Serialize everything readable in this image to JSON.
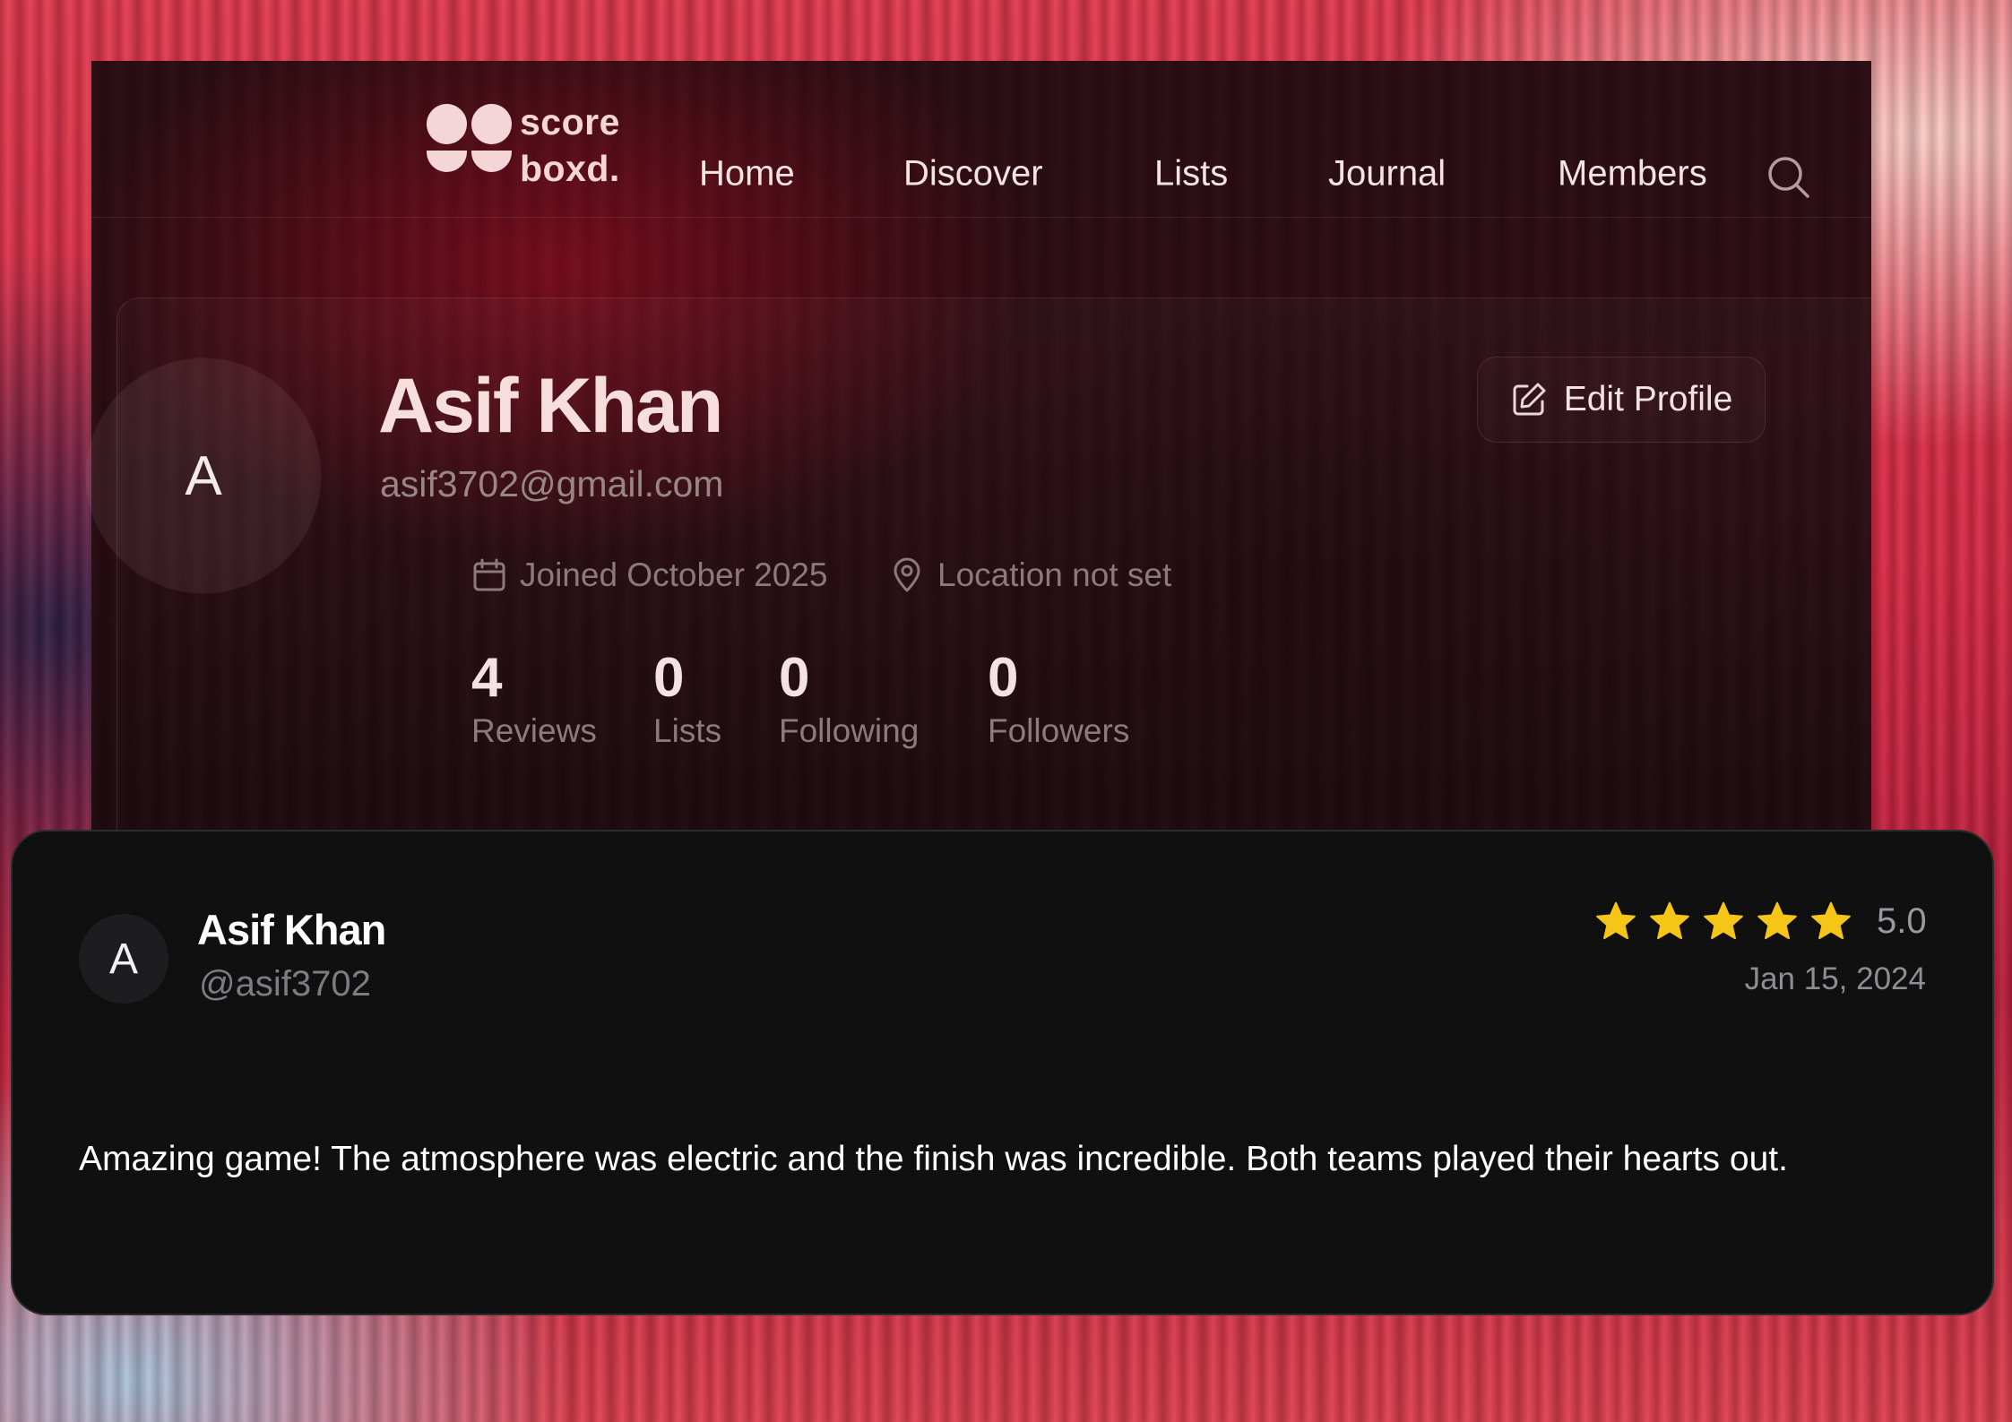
{
  "brand": {
    "logo_line1": "score",
    "logo_line2": "boxd.",
    "logo_color": "#f5d6d8"
  },
  "nav": {
    "items": [
      "Home",
      "Discover",
      "Lists",
      "Journal",
      "Members"
    ],
    "search_icon": "search-icon"
  },
  "profile": {
    "avatar_initial": "A",
    "name": "Asif Khan",
    "email": "asif3702@gmail.com",
    "joined": "Joined October 2025",
    "location": "Location not set",
    "edit_label": "Edit Profile",
    "stats": [
      {
        "value": "4",
        "label": "Reviews"
      },
      {
        "value": "0",
        "label": "Lists"
      },
      {
        "value": "0",
        "label": "Following"
      },
      {
        "value": "0",
        "label": "Followers"
      }
    ]
  },
  "review": {
    "avatar_initial": "A",
    "name": "Asif Khan",
    "handle": "@asif3702",
    "rating": "5.0",
    "stars_filled": 5,
    "star_color": "#f5c518",
    "date": "Jan 15, 2024",
    "text": "Amazing game! The atmosphere was electric and the finish was incredible. Both teams played their hearts out."
  }
}
